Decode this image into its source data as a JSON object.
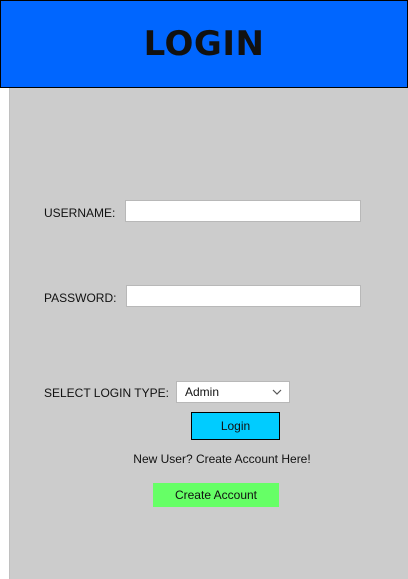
{
  "header": {
    "title": "LOGIN"
  },
  "form": {
    "username_label": "USERNAME:",
    "username_value": "",
    "password_label": "PASSWORD:",
    "password_value": "",
    "login_type_label": "SELECT LOGIN TYPE:",
    "login_type_selected": "Admin",
    "login_button": "Login",
    "new_user_text": "New User? Create Account Here!",
    "create_account_button": "Create Account"
  },
  "colors": {
    "header_bg": "#0066ff",
    "window_bg": "#cccccc",
    "login_button_bg": "#00ccff",
    "create_button_bg": "#66ff66"
  },
  "icons": {
    "dropdown": "chevron-down-icon"
  }
}
